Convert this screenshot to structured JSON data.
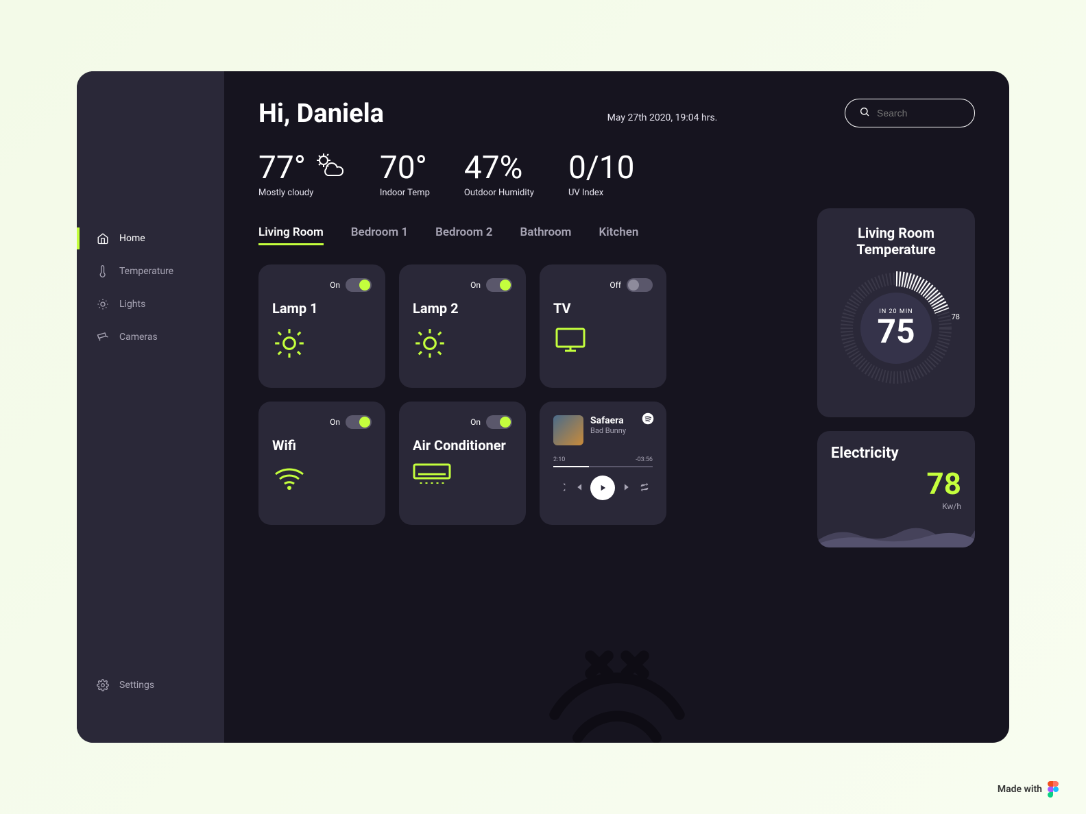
{
  "sidebar": {
    "items": [
      {
        "label": "Home",
        "icon": "home",
        "active": true
      },
      {
        "label": "Temperature",
        "icon": "thermometer",
        "active": false
      },
      {
        "label": "Lights",
        "icon": "bulb",
        "active": false
      },
      {
        "label": "Cameras",
        "icon": "camera",
        "active": false
      }
    ],
    "settings_label": "Settings"
  },
  "header": {
    "greeting": "Hi, Daniela",
    "datetime": "May 27th 2020, 19:04 hrs.",
    "search_placeholder": "Search"
  },
  "weather": {
    "outdoor_temp": "77°",
    "outdoor_label": "Mostly cloudy",
    "indoor_temp": "70°",
    "indoor_label": "Indoor Temp",
    "humidity": "47%",
    "humidity_label": "Outdoor Humidity",
    "uv": "0/10",
    "uv_label": "UV Index"
  },
  "tabs": [
    {
      "label": "Living Room",
      "active": true
    },
    {
      "label": "Bedroom 1",
      "active": false
    },
    {
      "label": "Bedroom 2",
      "active": false
    },
    {
      "label": "Bathroom",
      "active": false
    },
    {
      "label": "Kitchen",
      "active": false
    }
  ],
  "devices": {
    "lamp1": {
      "name": "Lamp 1",
      "state": "On",
      "on": true
    },
    "lamp2": {
      "name": "Lamp 2",
      "state": "On",
      "on": true
    },
    "tv": {
      "name": "TV",
      "state": "Off",
      "on": false
    },
    "wifi": {
      "name": "Wifi",
      "state": "On",
      "on": true
    },
    "ac": {
      "name": "Air Conditioner",
      "state": "On",
      "on": true
    }
  },
  "music": {
    "title": "Safaera",
    "artist": "Bad Bunny",
    "elapsed": "2:10",
    "remaining": "-03:56"
  },
  "thermostat": {
    "title": "Living Room Temperature",
    "timer": "IN 20 MIN",
    "current": "75",
    "target": "78"
  },
  "electricity": {
    "title": "Electricity",
    "value": "78",
    "unit": "Kw/h"
  },
  "footer": {
    "made_with": "Made with"
  },
  "colors": {
    "accent": "#c4ff3d",
    "card_bg": "#2a2838",
    "app_bg": "#16141f"
  }
}
